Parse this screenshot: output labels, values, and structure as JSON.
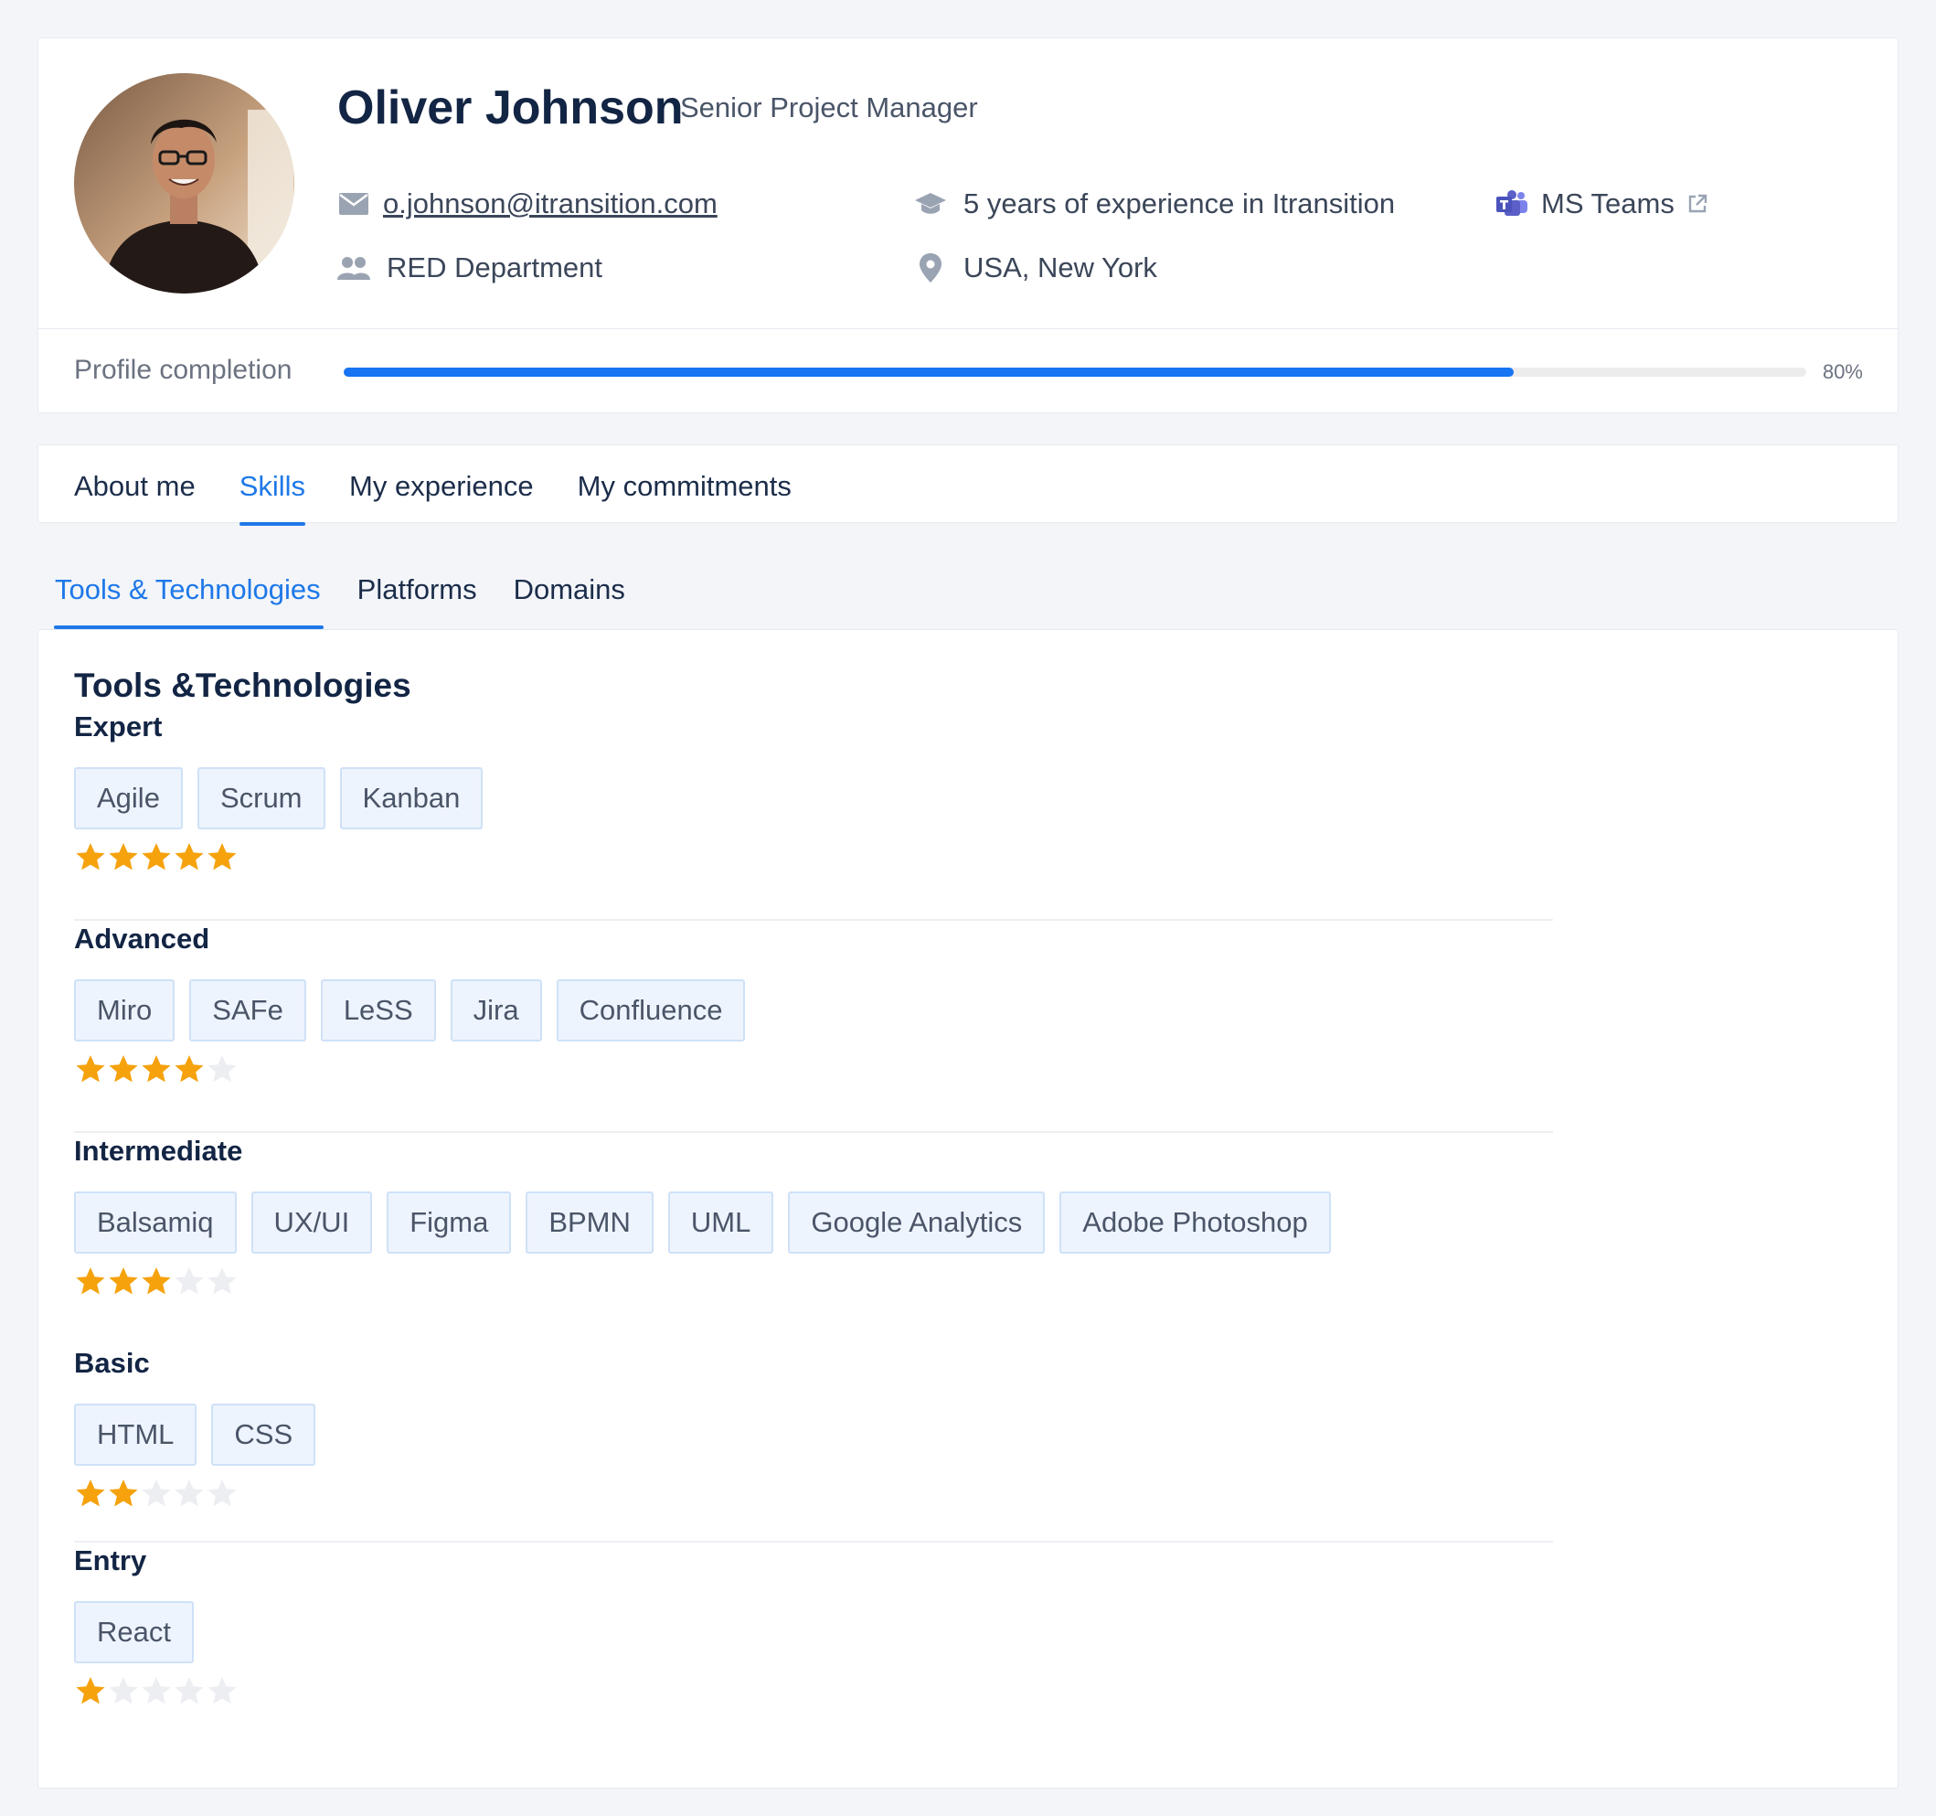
{
  "profile": {
    "name": "Oliver Johnson",
    "role": "Senior Project Manager",
    "email": "o.johnson@itransition.com",
    "experience": "5 years of experience in Itransition",
    "teams_label": "MS Teams",
    "department": "RED Department",
    "location": "USA, New York",
    "completion_label": "Profile completion",
    "completion_percent": 80,
    "completion_text": "80%"
  },
  "main_tabs": [
    {
      "label": "About me",
      "active": false
    },
    {
      "label": "Skills",
      "active": true
    },
    {
      "label": "My experience",
      "active": false
    },
    {
      "label": "My commitments",
      "active": false
    }
  ],
  "sub_tabs": [
    {
      "label": "Tools & Technologies",
      "active": true
    },
    {
      "label": "Platforms",
      "active": false
    },
    {
      "label": "Domains",
      "active": false
    }
  ],
  "skills": {
    "title": "Tools &Technologies",
    "levels": [
      {
        "name": "Expert",
        "rating": 5,
        "items": [
          "Agile",
          "Scrum",
          "Kanban"
        ]
      },
      {
        "name": "Advanced",
        "rating": 4,
        "items": [
          "Miro",
          "SAFe",
          "LeSS",
          "Jira",
          "Confluence"
        ]
      },
      {
        "name": "Intermediate",
        "rating": 3,
        "items": [
          "Balsamiq",
          "UX/UI",
          "Figma",
          "BPMN",
          "UML",
          "Google Analytics",
          "Adobe Photoshop"
        ]
      },
      {
        "name": "Basic",
        "rating": 2,
        "items": [
          "HTML",
          "CSS"
        ]
      },
      {
        "name": "Entry",
        "rating": 1,
        "items": [
          "React"
        ]
      }
    ],
    "max_rating": 5
  },
  "colors": {
    "accent": "#1e78e8",
    "progress": "#1774f2",
    "star_filled": "#f5a20d",
    "star_empty": "#eceef2",
    "chip_bg": "#eef4fd",
    "chip_border": "#cfe1f8",
    "teams_icon": "#5b5fc7"
  },
  "icons": {
    "email": "envelope-icon",
    "experience": "graduation-cap-icon",
    "teams": "ms-teams-icon",
    "external": "external-link-icon",
    "department": "users-icon",
    "location": "map-pin-icon",
    "rating": "star-icon"
  }
}
